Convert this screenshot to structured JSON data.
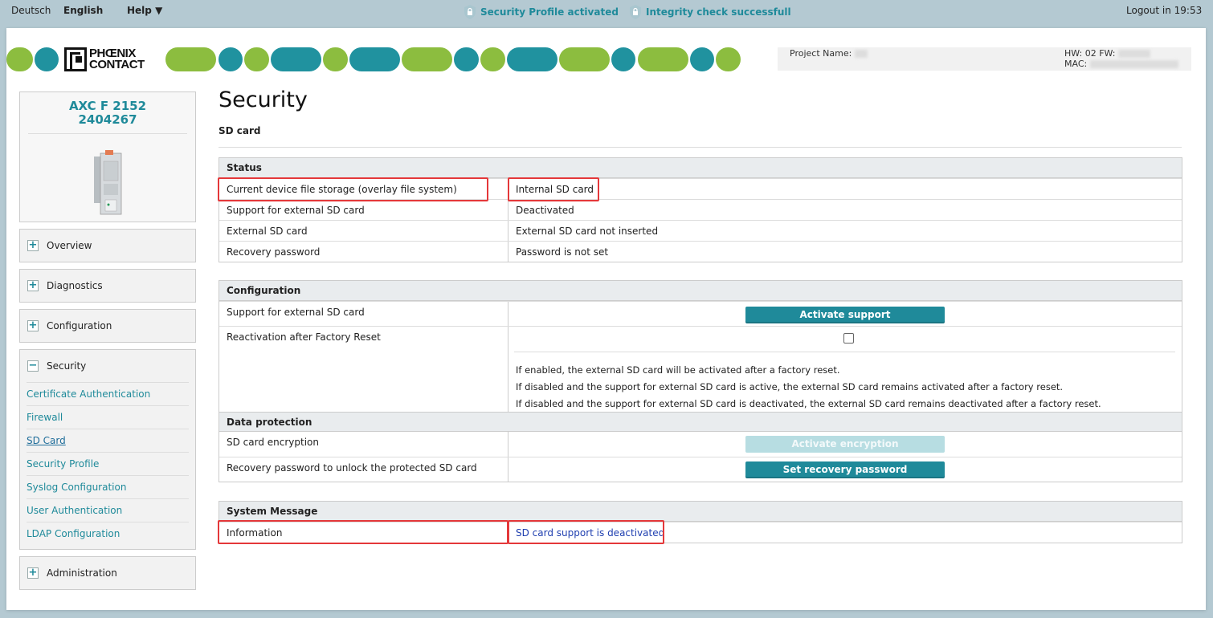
{
  "topbar": {
    "lang_de": "Deutsch",
    "lang_en": "English",
    "help": "Help ▼",
    "status1": "Security Profile activated",
    "status2": "Integrity check successfull",
    "logout": "Logout in 19:53"
  },
  "header": {
    "logo_line1": "PHŒNIX",
    "logo_line2": "CONTACT",
    "project_label": "Project Name:",
    "hw_label": "HW: 02 FW:",
    "mac_label": "MAC:"
  },
  "device": {
    "model": "AXC F 2152",
    "article": "2404267"
  },
  "nav": {
    "overview": "Overview",
    "diagnostics": "Diagnostics",
    "configuration": "Configuration",
    "security": "Security",
    "administration": "Administration",
    "security_items": [
      "Certificate Authentication",
      "Firewall",
      "SD Card",
      "Security Profile",
      "Syslog Configuration",
      "User Authentication",
      "LDAP Configuration"
    ]
  },
  "page": {
    "title": "Security",
    "subtitle": "SD card"
  },
  "status": {
    "heading": "Status",
    "rows": [
      {
        "label": "Current device file storage (overlay file system)",
        "value": "Internal SD card"
      },
      {
        "label": "Support for external SD card",
        "value": "Deactivated"
      },
      {
        "label": "External SD card",
        "value": "External SD card not inserted"
      },
      {
        "label": "Recovery password",
        "value": "Password is not set"
      }
    ]
  },
  "configuration": {
    "heading": "Configuration",
    "support_label": "Support for external SD card",
    "support_button": "Activate support",
    "reactivation_label": "Reactivation after Factory Reset",
    "reactivation_checked": false,
    "notes": [
      "If enabled, the external SD card will be activated after a factory reset.",
      "If disabled and the support for external SD card is active, the external SD card remains activated after a factory reset.",
      "If disabled and the support for external SD card is deactivated, the external SD card remains deactivated after a factory reset."
    ]
  },
  "data_protection": {
    "heading": "Data protection",
    "encryption_label": "SD card encryption",
    "encryption_button": "Activate encryption",
    "encryption_enabled": false,
    "recovery_label": "Recovery password to unlock the protected SD card",
    "recovery_button": "Set recovery password"
  },
  "system_message": {
    "heading": "System Message",
    "label": "Information",
    "value": "SD card support is deactivated"
  },
  "colors": {
    "accent": "#1f8a9a",
    "brand_green": "#8cbd3f",
    "highlight": "#e4383a"
  }
}
